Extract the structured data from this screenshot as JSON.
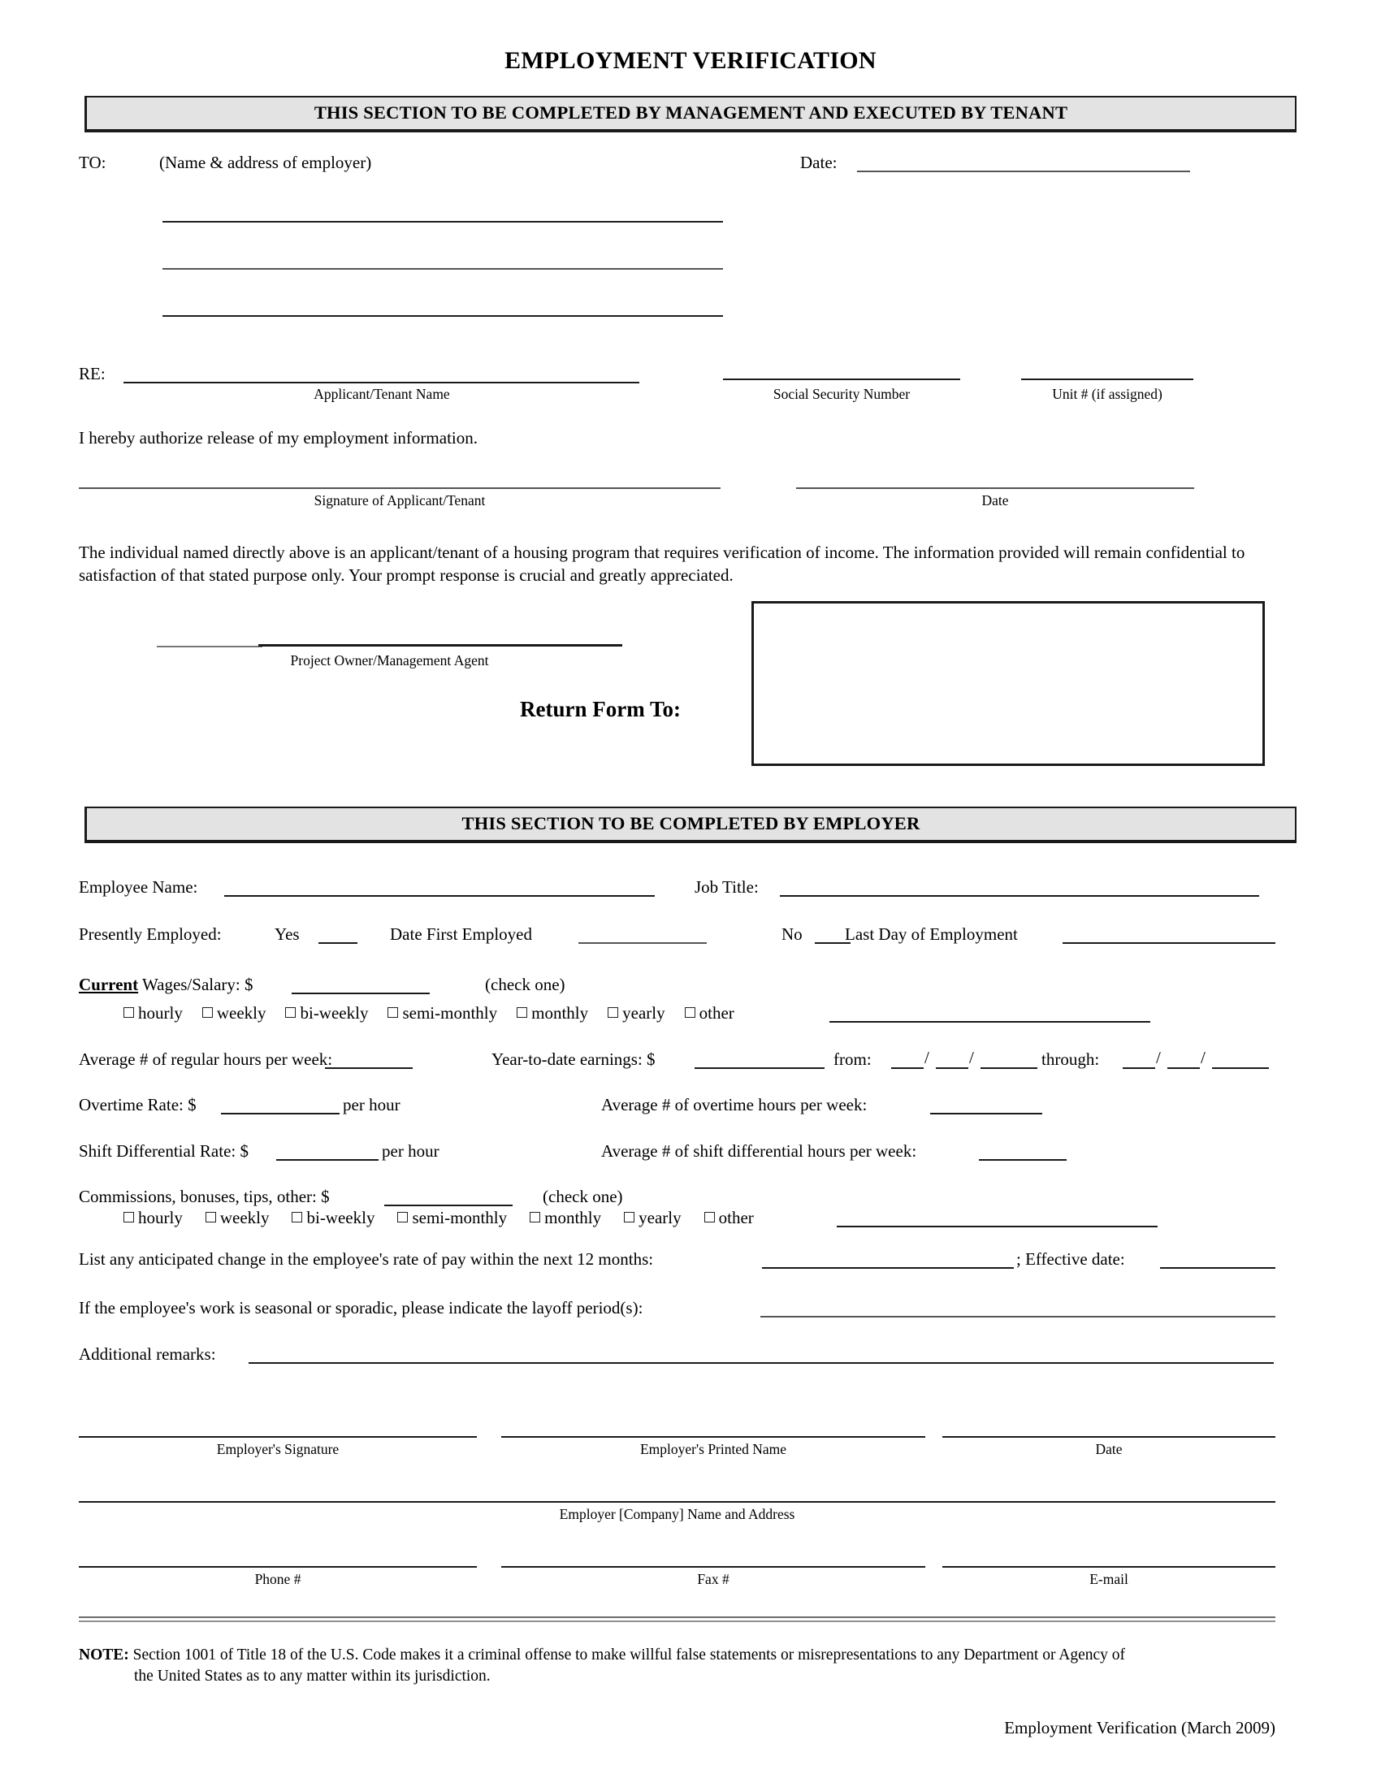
{
  "document": {
    "title": "EMPLOYMENT VERIFICATION",
    "footer_id": "Employment Verification (March 2009)"
  },
  "section_management": {
    "banner": "THIS SECTION TO BE COMPLETED BY MANAGEMENT AND EXECUTED BY TENANT",
    "to_label": "TO:",
    "to_hint": "(Name & address of employer)",
    "date_label": "Date:",
    "re_label": "RE:",
    "caption_applicant": "Applicant/Tenant Name",
    "caption_ssn": "Social Security Number",
    "caption_unit": "Unit # (if assigned)",
    "authorize": "I hereby authorize release of my employment information.",
    "caption_signature": "Signature of Applicant/Tenant",
    "caption_date": "Date",
    "confidentiality": "The individual named directly above is an applicant/tenant of a housing program that requires verification of income. The information provided will remain confidential to satisfaction of that stated purpose only. Your prompt response is crucial and greatly appreciated.",
    "caption_owner": "Project Owner/Management Agent",
    "return_form_to": "Return Form To:"
  },
  "section_employer": {
    "banner": "THIS SECTION TO BE COMPLETED BY EMPLOYER",
    "employee_name_label": "Employee Name:",
    "job_title_label": "Job Title:",
    "presently_employed_label": "Presently Employed:",
    "yes_label": "Yes",
    "date_first_employed_label": "Date First Employed",
    "no_label": "No",
    "last_day_label": "Last Day of Employment",
    "current_word": "Current",
    "wages_label": " Wages/Salary:  $",
    "check_one": "(check one)",
    "pay_frequency_options": [
      "hourly",
      "weekly",
      "bi-weekly",
      "semi-monthly",
      "monthly",
      "yearly",
      "other"
    ],
    "avg_regular_hours_label": "Average # of regular hours per week:",
    "ytd_label": "Year-to-date earnings: $",
    "from_label": "from:",
    "through_label": "through:",
    "date_slash": "/",
    "overtime_rate_label": "Overtime Rate:  $",
    "per_hour_label": "per hour",
    "avg_overtime_label": "Average # of overtime hours per week:",
    "shift_diff_label": "Shift Differential Rate:  $",
    "avg_shift_diff_label": "Average # of shift differential hours per week:",
    "commissions_label": "Commissions, bonuses, tips, other:  $",
    "anticipated_change_label": "List any anticipated change in the employee's rate of pay within the next 12 months:",
    "effective_date_label": "; Effective date:",
    "seasonal_label": "If the employee's work is seasonal or sporadic, please indicate the layoff period(s):",
    "additional_remarks_label": "Additional remarks:",
    "caption_employer_signature": "Employer's Signature",
    "caption_employer_printed": "Employer's Printed Name",
    "caption_employer_date": "Date",
    "caption_company": "Employer [Company] Name and Address",
    "caption_phone": "Phone #",
    "caption_fax": "Fax #",
    "caption_email": "E-mail"
  },
  "note": {
    "label": "NOTE:",
    "line1": "Section 1001 of Title 18 of the U.S. Code makes it a criminal offense to make willful false statements or misrepresentations to any Department or Agency of",
    "line2": "the United States as to any matter within its jurisdiction."
  },
  "colors": {
    "banner_fill": "#e3e3e3",
    "ink": "#000000",
    "rule": "#1a1a1a"
  }
}
